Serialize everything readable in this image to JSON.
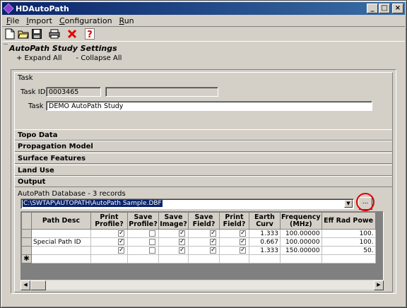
{
  "window": {
    "title": "HDAutoPath"
  },
  "menu": {
    "items": [
      "File",
      "Import",
      "Configuration",
      "Run"
    ]
  },
  "toolbar": {
    "icons": [
      "new-file-icon",
      "open-folder-icon",
      "save-icon",
      "print-icon",
      "delete-icon",
      "help-icon"
    ]
  },
  "settings": {
    "title": "AutoPath Study Settings",
    "expand_all": "+ Expand All",
    "collapse_all": "- Collapse All"
  },
  "task": {
    "title": "Task",
    "id_label": "Task ID:",
    "id_value": "0003465",
    "name_label": "Task",
    "name_value": "DEMO AutoPath Study"
  },
  "sections": [
    "Topo Data",
    "Propagation Model",
    "Surface Features",
    "Land Use",
    "Output"
  ],
  "database": {
    "title": "AutoPath Database - 3 records",
    "path": "C:\\SWTAP\\AUTOPATH\\AutoPath Sample.DBF",
    "browse_label": "...",
    "columns": [
      "Path Desc",
      "Print Profile?",
      "Save Profile?",
      "Save Image?",
      "Save Field?",
      "Print Field?",
      "Earth Curv",
      "Frequency (MHz)",
      "Eff Rad Powe"
    ],
    "rows": [
      {
        "desc": "",
        "print_profile": true,
        "save_profile": false,
        "save_image": true,
        "save_field": true,
        "print_field": true,
        "earth_curv": "1.333",
        "frequency": "100.00000",
        "erp": "100."
      },
      {
        "desc": "Special Path ID",
        "print_profile": true,
        "save_profile": false,
        "save_image": true,
        "save_field": true,
        "print_field": true,
        "earth_curv": "0.667",
        "frequency": "100.00000",
        "erp": "100."
      },
      {
        "desc": "",
        "print_profile": true,
        "save_profile": false,
        "save_image": true,
        "save_field": true,
        "print_field": true,
        "earth_curv": "1.333",
        "frequency": "150.00000",
        "erp": "50."
      }
    ],
    "new_row_marker": "✱"
  },
  "colors": {
    "titlebar": "#0a246a",
    "selection": "#0a246a",
    "highlight_ring": "#e00000"
  }
}
